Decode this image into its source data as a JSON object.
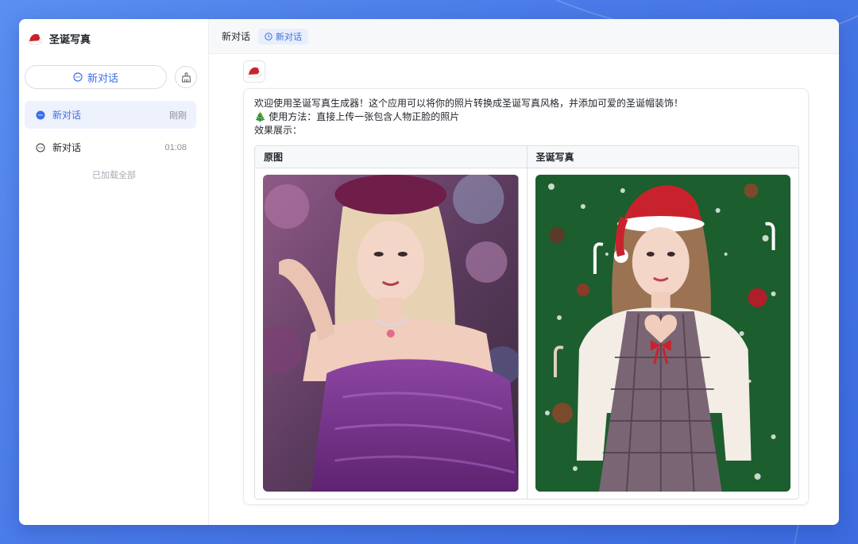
{
  "app": {
    "name": "圣诞写真",
    "logo_icon": "santa-hat-icon"
  },
  "sidebar": {
    "new_chat_label": "新对话",
    "new_chat_icon": "chat-bubble-icon",
    "clean_icon": "broom-icon",
    "conversations": [
      {
        "title": "新对话",
        "time": "刚刚",
        "active": true
      },
      {
        "title": "新对话",
        "time": "01:08",
        "active": false
      }
    ],
    "loaded_all": "已加载全部"
  },
  "topbar": {
    "title": "新对话",
    "tag_label": "新对话",
    "tag_icon": "clock-icon"
  },
  "message": {
    "line1": "欢迎使用圣诞写真生成器！这个应用可以将你的照片转换成圣诞写真风格，并添加可爱的圣诞帽装饰！",
    "line2": "🎄 使用方法：直接上传一张包含人物正脸的照片",
    "line3": "效果展示：",
    "table": {
      "col1": "原图",
      "col2": "圣诞写真"
    }
  },
  "colors": {
    "accent": "#3b6ee6",
    "background": "#4a7be8",
    "original_photo_tone": "#7a3d8c",
    "christmas_bg": "#1c5e2e",
    "santa_red": "#c8232c"
  }
}
